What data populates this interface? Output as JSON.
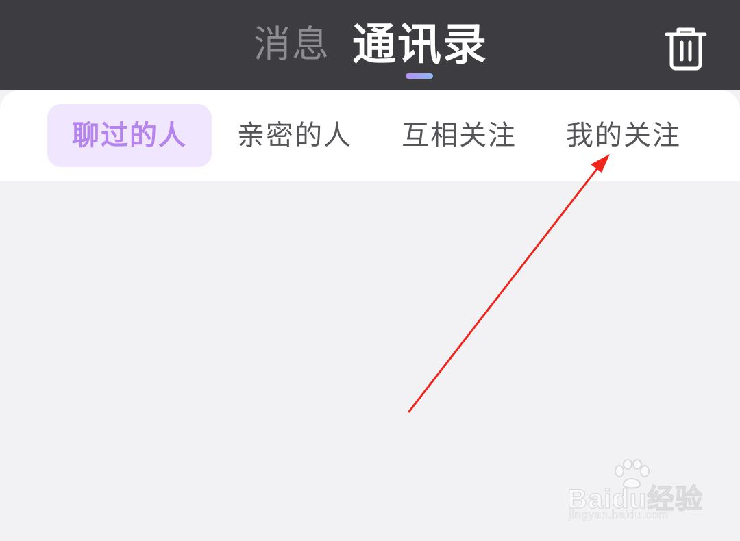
{
  "header": {
    "tab_messages": "消息",
    "tab_contacts": "通讯录",
    "trash_icon": "trash-icon"
  },
  "subtabs": [
    {
      "label": "聊过的人",
      "active": true
    },
    {
      "label": "亲密的人",
      "active": false
    },
    {
      "label": "互相关注",
      "active": false
    },
    {
      "label": "我的关注",
      "active": false
    }
  ],
  "watermark": {
    "brand": "Baidu经验",
    "url": "jingyan.baidu.com"
  },
  "colors": {
    "header_bg": "#3d3c41",
    "active_tab_bg": "#f0e6fd",
    "active_tab_text": "#b584ee",
    "annotation_arrow": "#f0241b",
    "page_bg": "#f2f2f4"
  }
}
